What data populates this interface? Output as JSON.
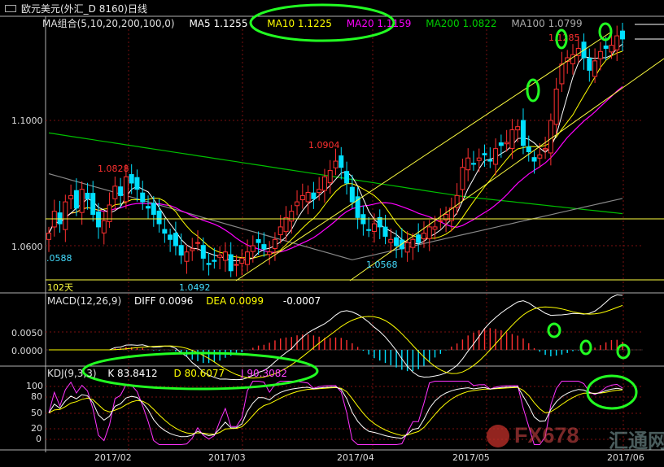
{
  "window": {
    "title": "欧元美元(外汇_D 8160)日线"
  },
  "ma_legend": {
    "label": "MA组合(5,10,20,200,100,0)",
    "ma5": "MA5 1.1255",
    "ma10": "MA10 1.1225",
    "ma20": "MA20 1.1159",
    "ma200": "MA200 1.0822",
    "ma100": "MA100 1.0799"
  },
  "macd_legend": {
    "label": "MACD(12,26,9)",
    "diff": "DIFF 0.0096",
    "dea": "DEA 0.0099",
    "macd": "-0.0007"
  },
  "kdj_legend": {
    "label": "KDJ(9,3,3)",
    "k": "K 83.8412",
    "d": "D 80.6077",
    "j": "J 90.3082"
  },
  "colors": {
    "up": "#ff3030",
    "down": "#00e0ff",
    "ma5": "#ffffff",
    "ma10": "#ffff00",
    "ma20": "#ff00ff",
    "ma200": "#00c000",
    "ma100": "#888888",
    "highlight": "#22ff22",
    "channel": "#ffff40",
    "grid": "#7a1010"
  },
  "chart_data": [
    {
      "type": "candlestick",
      "title": "欧元美元(外汇_D 8160)日线",
      "x_ticks": [
        "2017/02",
        "2017/03",
        "2017/04",
        "2017/05",
        "2017/06"
      ],
      "y_ticks": [
        "1.1000",
        "1.0600"
      ],
      "ylim": [
        1.048,
        1.131
      ],
      "annotations": [
        {
          "text": "1.0828",
          "value": 1.0828,
          "x": "2017/02"
        },
        {
          "text": "1.0904",
          "value": 1.0904,
          "x": "2017/04"
        },
        {
          "text": "1.1285",
          "value": 1.1285,
          "x": "2017/06"
        },
        {
          "text": ".0588",
          "value": 1.0588
        },
        {
          "text": "1.0492",
          "value": 1.0492
        },
        {
          "text": "1.0568",
          "value": 1.0568
        }
      ],
      "footer_label": "102天",
      "closes": [
        1.064,
        1.071,
        1.067,
        1.074,
        1.076,
        1.072,
        1.078,
        1.075,
        1.07,
        1.066,
        1.068,
        1.073,
        1.079,
        1.076,
        1.082,
        1.08,
        1.078,
        1.074,
        1.072,
        1.07,
        1.067,
        1.064,
        1.062,
        1.06,
        1.057,
        1.058,
        1.059,
        1.061,
        1.056,
        1.054,
        1.055,
        1.057,
        1.058,
        1.052,
        1.054,
        1.056,
        1.058,
        1.06,
        1.061,
        1.059,
        1.058,
        1.062,
        1.066,
        1.069,
        1.071,
        1.074,
        1.076,
        1.077,
        1.075,
        1.078,
        1.082,
        1.084,
        1.087,
        1.085,
        1.08,
        1.074,
        1.069,
        1.067,
        1.065,
        1.067,
        1.066,
        1.063,
        1.062,
        1.06,
        1.059,
        1.061,
        1.062,
        1.061,
        1.064,
        1.066,
        1.066,
        1.068,
        1.07,
        1.072,
        1.076,
        1.085,
        1.088,
        1.086,
        1.088,
        1.089,
        1.087,
        1.091,
        1.092,
        1.093,
        1.097,
        1.098,
        1.092,
        1.09,
        1.087,
        1.089,
        1.091,
        1.1,
        1.11,
        1.118,
        1.12,
        1.121,
        1.123,
        1.12,
        1.116,
        1.119,
        1.122,
        1.123,
        1.124,
        1.127,
        1.126
      ],
      "ma_series": [
        {
          "name": "MA5"
        },
        {
          "name": "MA10"
        },
        {
          "name": "MA20"
        },
        {
          "name": "MA200"
        },
        {
          "name": "MA100"
        }
      ]
    },
    {
      "type": "bar",
      "title": "MACD(12,26,9)",
      "y_ticks": [
        "0.0050",
        "0.0000"
      ],
      "series": [
        {
          "name": "DIFF"
        },
        {
          "name": "DEA"
        }
      ]
    },
    {
      "type": "line",
      "title": "KDJ(9,3,3)",
      "y_ticks": [
        "100",
        "80",
        "50",
        "20",
        "0"
      ],
      "series": [
        {
          "name": "K"
        },
        {
          "name": "D"
        },
        {
          "name": "J"
        }
      ]
    }
  ],
  "watermark": {
    "brand": "FX678",
    "cn": "汇通网"
  }
}
